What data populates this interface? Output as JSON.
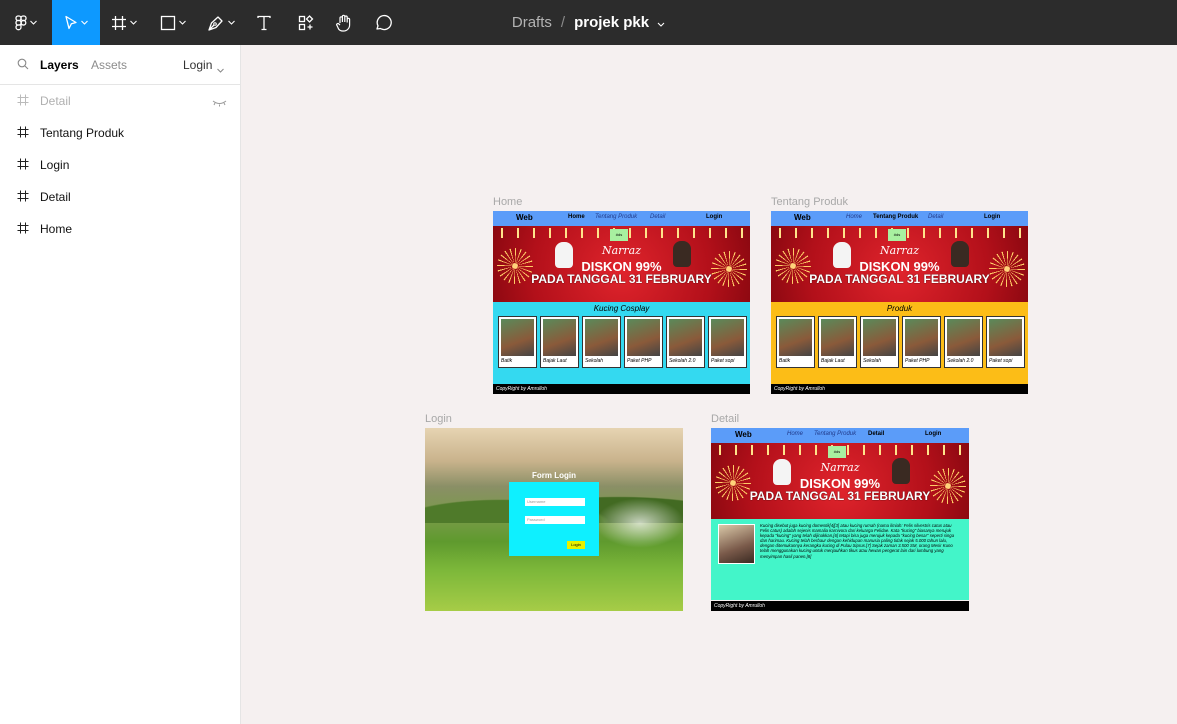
{
  "toolbar": {
    "doc_location": "Drafts",
    "separator": "/",
    "doc_name": "projek pkk",
    "icons": [
      "figma-menu-icon",
      "move-tool-icon",
      "frame-tool-icon",
      "shape-tool-icon",
      "pen-tool-icon",
      "text-tool-icon",
      "resources-icon",
      "hand-tool-icon",
      "comment-icon"
    ]
  },
  "sidebar": {
    "tabs": {
      "layers": "Layers",
      "assets": "Assets",
      "page": "Login"
    },
    "layers": [
      {
        "name": "Detail",
        "hidden": true
      },
      {
        "name": "Tentang Produk",
        "hidden": false
      },
      {
        "name": "Login",
        "hidden": false
      },
      {
        "name": "Detail",
        "hidden": false
      },
      {
        "name": "Home",
        "hidden": false
      }
    ]
  },
  "frames": {
    "home": {
      "label": "Home",
      "nav": {
        "brand": "Web",
        "home": "Home",
        "about": "Tentang Produk",
        "detail": "Detail",
        "login": "Login"
      },
      "banner": {
        "badge": "#ds",
        "sub": "Narraz",
        "big": "DISKON 99%",
        "big2": "PADA TANGGAL 31 FEBRUARY"
      },
      "section_title": "Kucing Cosplay",
      "cards": [
        "Batik",
        "Bajak Laut",
        "Sekolah",
        "Paket PHP",
        "Sekolah 2.0",
        "Paket sopi"
      ],
      "footer": "CopyRight by Amrulloh"
    },
    "tentang": {
      "label": "Tentang Produk",
      "nav": {
        "brand": "Web",
        "home": "Home",
        "about": "Tentang Produk",
        "detail": "Detail",
        "login": "Login"
      },
      "banner": {
        "badge": "#ds",
        "sub": "Narraz",
        "big": "DISKON 99%",
        "big2": "PADA TANGGAL 31 FEBRUARY"
      },
      "section_title": "Produk",
      "cards": [
        "Batik",
        "Bajak Laut",
        "Sekolah",
        "Paket PHP",
        "Sekolah 2.0",
        "Paket sopi"
      ],
      "footer": "CopyRight by Amrulloh"
    },
    "login": {
      "label": "Login",
      "form_title": "Form Login",
      "username_placeholder": "Username",
      "password_placeholder": "Password",
      "button": "Login"
    },
    "detail": {
      "label": "Detail",
      "nav": {
        "brand": "Web",
        "home": "Home",
        "about": "Tentang Produk",
        "detail": "Detail",
        "login": "Login"
      },
      "banner": {
        "badge": "#ds",
        "sub": "Narraz",
        "big": "DISKON 99%",
        "big2": "PADA TANGGAL 31 FEBRUARY"
      },
      "text": "Kucing disebut juga kucing domestik[4][3] atau kucing rumah (nama ilmiah: Felis silvestris catus atau Felis catus) adalah sejenis mamalia karnivora dari keluarga Felidae. Kata \"kucing\" biasanya merujuk kepada \"kucing\" yang telah dijinakkan,[6] tetapi bisa juga merujuk kepada \"kucing besar\" seperti singa dan harimau. Kucing telah berbaur dengan kehidupan manusia paling tidak sejak 5.000 tahun lalu, dengan ditemukannya kerangka kucing di Pulau Siprus.[7] Sejak zaman 3.500 SM, orang Mesir Kuno telah menggunakan kucing untuk menjauhkan tikus atau hewan pengerat lain dari lumbung yang menyimpan hasil panen.[8]",
      "footer": "CopyRight by Amrulloh"
    }
  },
  "colors": {
    "toolbar": "#2c2c2c",
    "active_tool": "#0d99ff",
    "canvas": "#f5f0f0",
    "nav": "#5b9cf9",
    "home_section": "#34d9f0",
    "tentang_section": "#fcbd17",
    "detail_section": "#43f5c9"
  }
}
